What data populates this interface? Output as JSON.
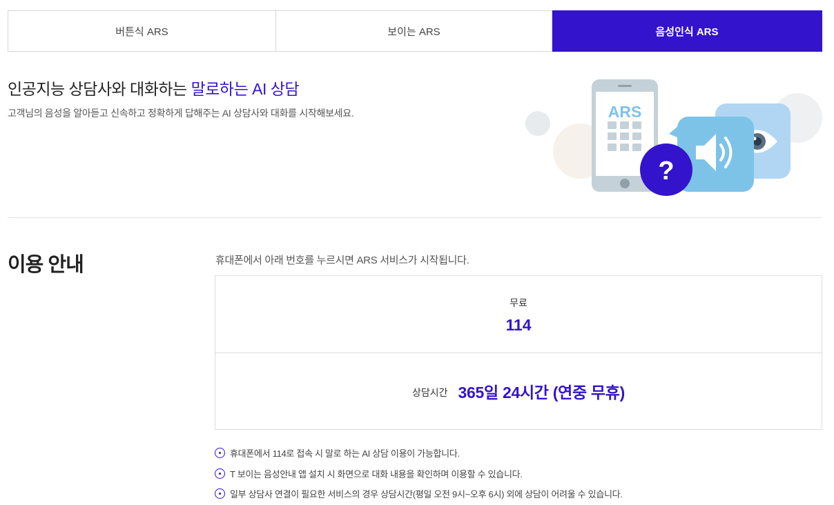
{
  "tabs": [
    {
      "label": "버튼식 ARS",
      "active": false
    },
    {
      "label": "보이는 ARS",
      "active": false
    },
    {
      "label": "음성인식 ARS",
      "active": true
    }
  ],
  "intro": {
    "title_prefix": "인공지능 상담사와 대화하는 ",
    "title_highlight": "말로하는 AI 상담",
    "description": "고객님의 음성을 알아듣고 신속하고 정확하게 답해주는 AI 상담사와 대화를 시작해보세요.",
    "illustration": {
      "phone_label": "ARS",
      "bubble_symbol": "?",
      "icons": [
        "phone-icon",
        "question-bubble-icon",
        "speaker-icon",
        "eye-icon"
      ]
    }
  },
  "usage": {
    "title": "이용 안내",
    "guide": "휴대폰에서 아래 번호를 누르시면 ARS 서비스가 시작됩니다.",
    "fee_label": "무료",
    "number": "114",
    "hours_label": "상담시간",
    "hours_value": "365일 24시간 (연중 무휴)"
  },
  "notes": [
    "휴대폰에서 114로 접속 시 말로 하는 AI 상담 이용이 가능합니다.",
    "T 보이는 음성안내 앱 설치 시 화면으로 대화 내용을 확인하며 이용할 수 있습니다.",
    "일부 상담사 연결이 필요한 서비스의 경우 상담시간(평일 오전 9시~오후 6시) 외에 상담이 어려울 수 있습니다."
  ],
  "colors": {
    "accent": "#3314cc",
    "phone_body": "#c5d1d8",
    "speaker_bubble": "#7dc3e8",
    "eye_bubble": "#b0d6f3"
  }
}
